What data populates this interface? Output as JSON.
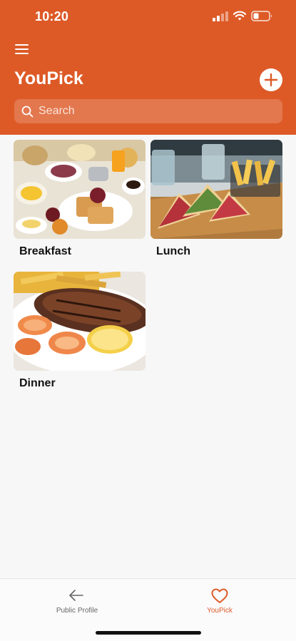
{
  "status_bar": {
    "time": "10:20"
  },
  "header": {
    "title": "YouPick",
    "search_placeholder": "Search",
    "background_color": "#dd5a27"
  },
  "cards": [
    {
      "label": "Breakfast",
      "image_icon": "breakfast-food-photo"
    },
    {
      "label": "Lunch",
      "image_icon": "lunch-sandwich-photo"
    },
    {
      "label": "Dinner",
      "image_icon": "dinner-steak-photo"
    }
  ],
  "tab_bar": {
    "tabs": [
      {
        "label": "Public Profile",
        "icon": "arrow-left-icon",
        "active": false
      },
      {
        "label": "YouPick",
        "icon": "heart-icon",
        "active": true
      }
    ],
    "active_color": "#dd5a27"
  }
}
